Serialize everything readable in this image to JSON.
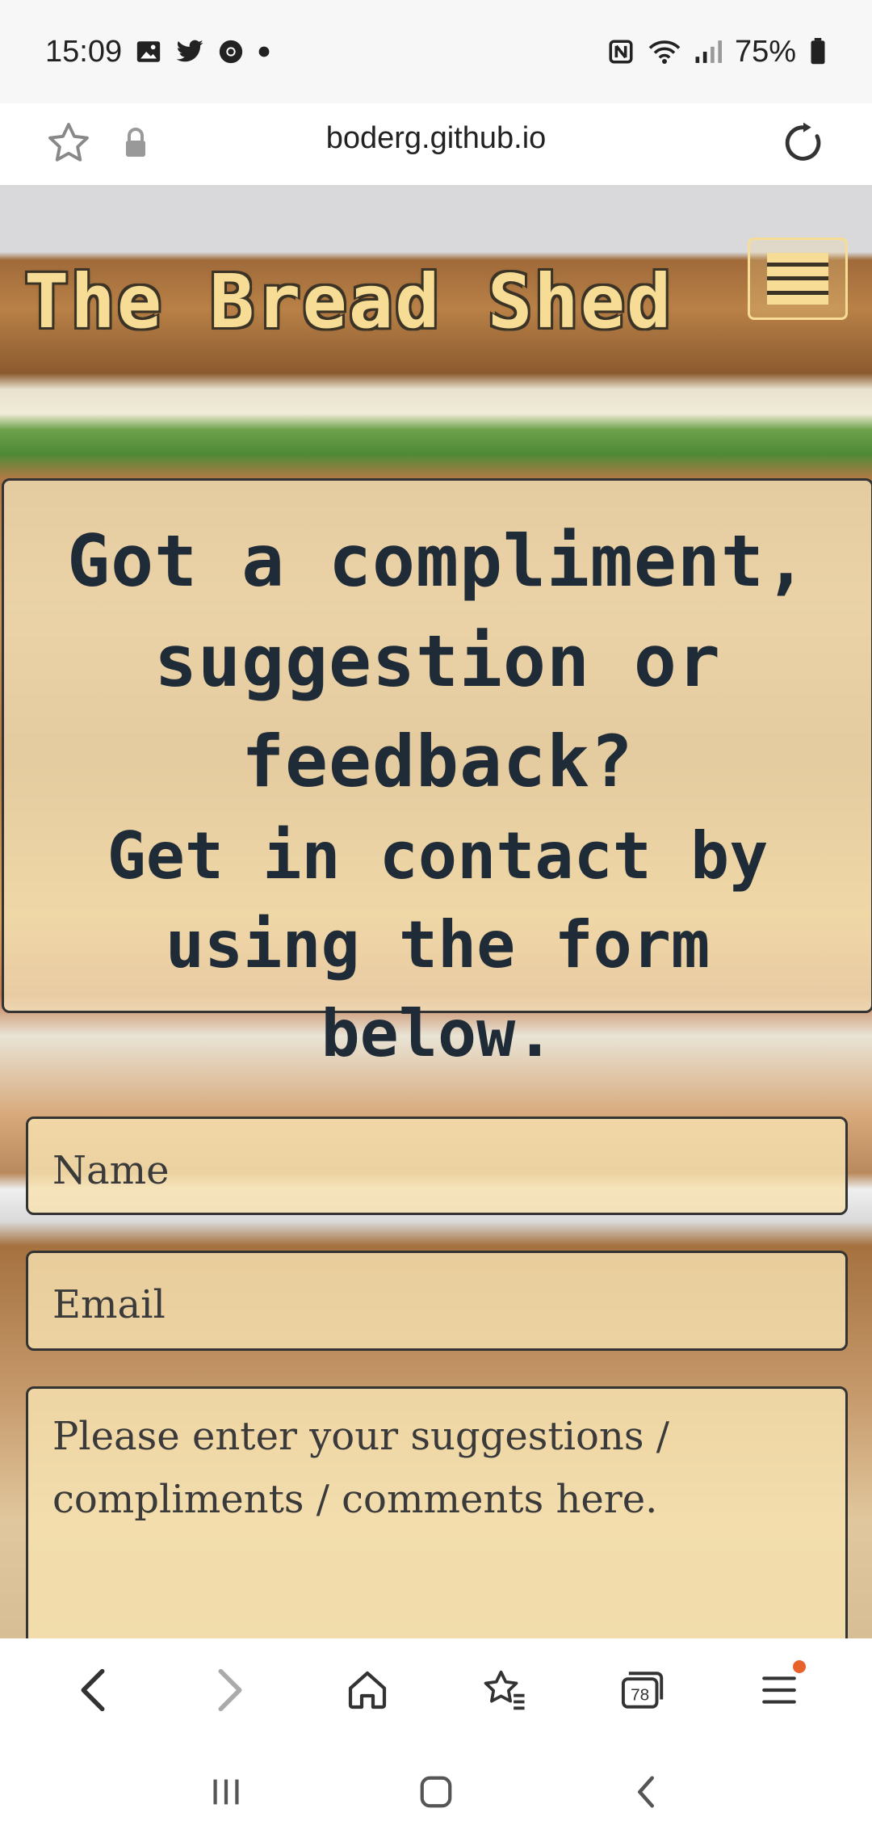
{
  "status_bar": {
    "time": "15:09",
    "battery": "75%",
    "left_icons": [
      "gallery-icon",
      "twitter-icon",
      "chrome-icon",
      "dot-icon"
    ],
    "right_icons": [
      "nfc-icon",
      "wifi-icon",
      "signal-icon",
      "battery-icon"
    ]
  },
  "url_bar": {
    "url": "boderg.github.io"
  },
  "site": {
    "title": "The Bread Shed",
    "menu_icon": "hamburger-menu-icon"
  },
  "feedback": {
    "heading": "Got a compliment, suggestion or feedback?",
    "subheading": "Get in contact by using the form below."
  },
  "form": {
    "name_placeholder": "Name",
    "email_placeholder": "Email",
    "message_placeholder": "Please enter your suggestions / compliments / comments here."
  },
  "bottom_toolbar": {
    "tabs_count": "78",
    "items": [
      "back-icon",
      "forward-icon",
      "home-icon",
      "bookmarks-icon",
      "tabs-icon",
      "menu-icon"
    ]
  },
  "system_nav": {
    "items": [
      "recent-apps-icon",
      "home-button-icon",
      "system-back-icon"
    ]
  },
  "colors": {
    "title_fill": "#f6dc94",
    "heading_text": "#1f2b37",
    "notify_dot": "#e8632b"
  }
}
